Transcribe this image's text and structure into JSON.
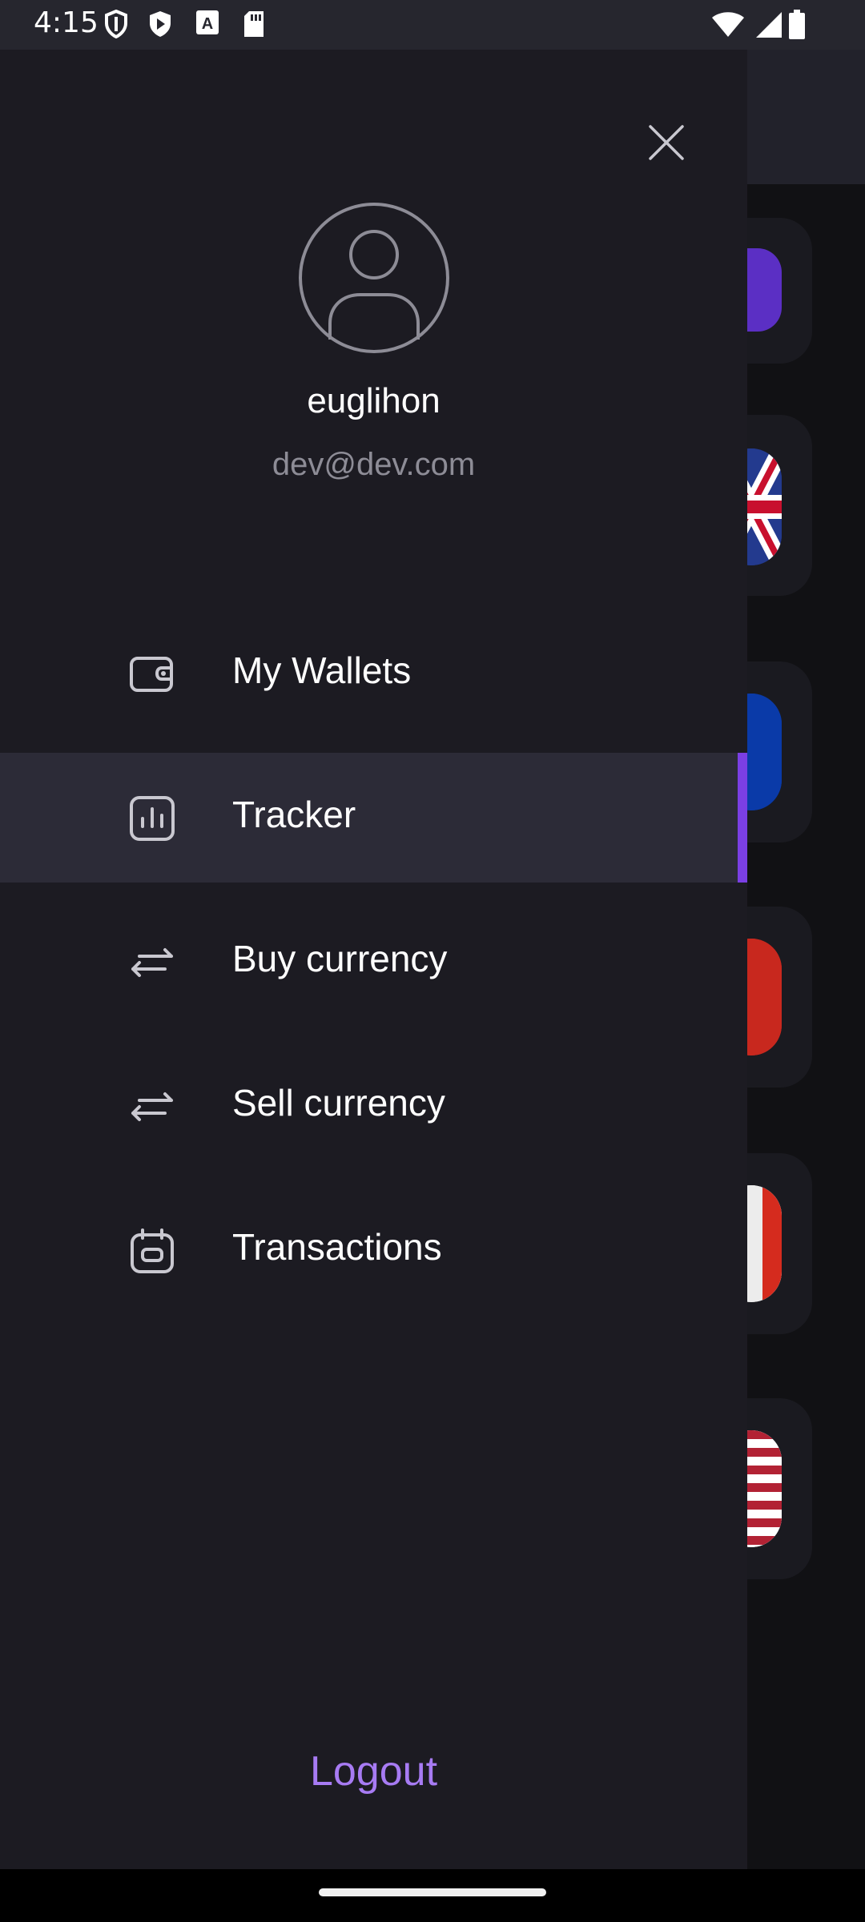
{
  "status_bar": {
    "time": "4:15",
    "left_icons": [
      "shield-icon",
      "play-protect-icon",
      "a-font-icon",
      "sd-card-icon"
    ],
    "right_icons": [
      "wifi-icon",
      "cellular-signal-icon",
      "battery-icon"
    ]
  },
  "drawer": {
    "close_icon": "close-icon",
    "profile": {
      "avatar_icon": "user-avatar-icon",
      "username": "euglihon",
      "email": "dev@dev.com"
    },
    "menu": [
      {
        "label": "My Wallets",
        "icon": "wallet-icon",
        "active": false
      },
      {
        "label": "Tracker",
        "icon": "chart-icon",
        "active": true
      },
      {
        "label": "Buy currency",
        "icon": "exchange-arrows-icon",
        "active": false
      },
      {
        "label": "Sell currency",
        "icon": "exchange-arrows-icon",
        "active": false
      },
      {
        "label": "Transactions",
        "icon": "calendar-icon",
        "active": false
      }
    ],
    "logout_label": "Logout"
  },
  "colors": {
    "drawer_bg": "#1c1b22",
    "active_item_bg": "#2c2b37",
    "accent": "#7b3fe4",
    "logout": "#a77bf3",
    "secondary_text": "#8d8c96"
  }
}
